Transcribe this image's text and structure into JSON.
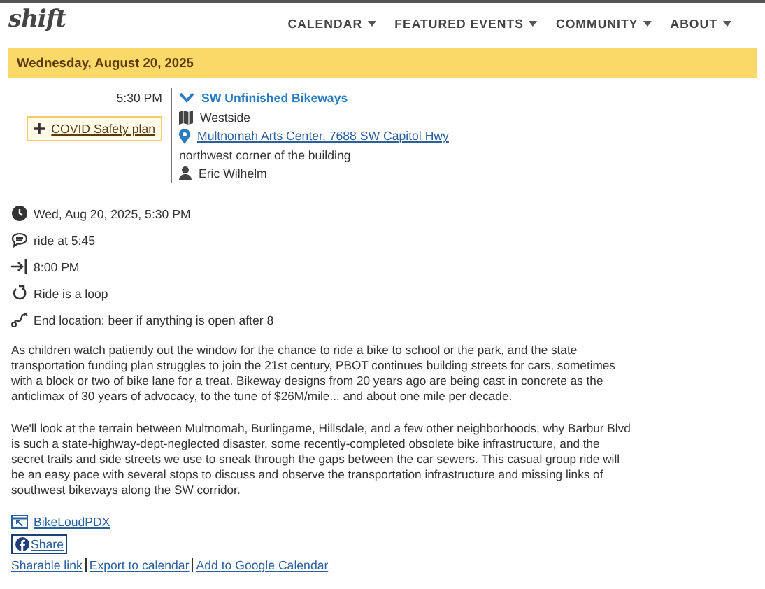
{
  "logo": {
    "text": "shift"
  },
  "nav": [
    {
      "label": "CALENDAR"
    },
    {
      "label": "FEATURED EVENTS"
    },
    {
      "label": "COMMUNITY"
    },
    {
      "label": "ABOUT"
    }
  ],
  "date_header": "Wednesday, August 20, 2025",
  "event": {
    "time": "5:30 PM",
    "safety_plan": "COVID Safety plan",
    "title": "SW Unfinished Bikeways",
    "expanded": true,
    "area": "Westside",
    "venue": "Multnomah Arts Center, 7688 SW Capitol Hwy",
    "location_details": "northwest corner of the building",
    "organizer": "Eric Wilhelm"
  },
  "details": [
    {
      "kind": "datetime",
      "text": "Wed, Aug 20, 2025, 5:30 PM"
    },
    {
      "kind": "note",
      "text": "ride at 5:45"
    },
    {
      "kind": "end_time",
      "text": "8:00 PM"
    },
    {
      "kind": "loop",
      "text": "Ride is a loop"
    },
    {
      "kind": "end_location",
      "text": "End location: beer if anything is open after 8"
    }
  ],
  "description": [
    "As children watch patiently out the window for the chance to ride a bike to school or the park, and the state transportation funding plan struggles to join the 21st century, PBOT continues building streets for cars, sometimes with a block or two of bike lane for a treat. Bikeway designs from 20 years ago are being cast in concrete as the anticlimax of 30 years of advocacy, to the tune of $26M/mile... and about one mile per decade.",
    "We'll look at the terrain between Multnomah, Burlingame, Hillsdale, and a few other neighborhoods, why Barbur Blvd is such a state-highway-dept-neglected disaster, some recently-completed obsolete bike infrastructure, and the secret trails and side streets we use to sneak through the gaps between the car sewers. This casual group ride will be an easy pace with several stops to discuss and observe the transportation infrastructure and missing links of southwest bikeways along the SW corridor."
  ],
  "web_link": "BikeLoudPDX",
  "share": "Share",
  "links": [
    "Sharable link",
    "Export to calendar",
    "Add to Google Calendar"
  ]
}
